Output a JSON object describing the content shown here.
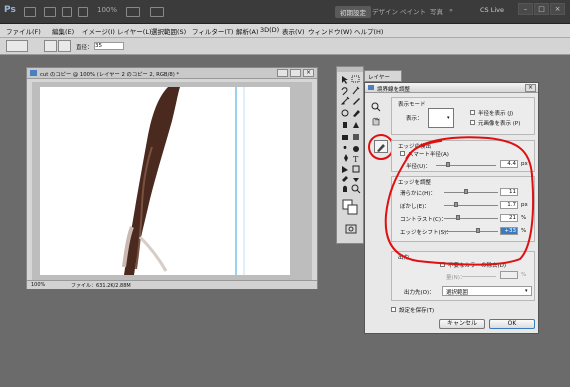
{
  "appbar": {
    "logo": "Ps",
    "zoom": "100%",
    "workspaces": [
      "初期設定",
      "デザイン",
      "ペイント",
      "写真"
    ],
    "cs_live": "CS Live",
    "more": "»"
  },
  "menu": {
    "items": [
      "ファイル(F)",
      "編集(E)",
      "イメージ(I)",
      "レイヤー(L)",
      "選択範囲(S)",
      "フィルター(T)",
      "解析(A)",
      "3D(D)",
      "表示(V)",
      "ウィンドウ(W)",
      "ヘルプ(H)"
    ]
  },
  "options": {
    "size_label": "直径：",
    "size_value": "35"
  },
  "document": {
    "title": "cut のコピー @ 100% (レイヤー 2 のコピー 2, RGB/8) *",
    "zoom": "100%",
    "file_info": "ファイル：631.2K/2.88M"
  },
  "layers_tab": "レイヤー",
  "dialog": {
    "title": "境界線を調整",
    "view_mode": {
      "group": "表示モード",
      "view_label": "表示：",
      "show_radius": "半径を表示 (J)",
      "show_original": "元画像を表示 (P)"
    },
    "edge_detection": {
      "group": "エッジの検出",
      "smart_radius": "スマート半径(A)",
      "radius_label": "半径(U)：",
      "radius_value": "4.4",
      "radius_unit": "px"
    },
    "adjust_edge": {
      "group": "エッジを調整",
      "rows": [
        {
          "label": "滑らかに(H)：",
          "value": "11",
          "unit": "",
          "pos": 0.4
        },
        {
          "label": "ぼかし(E)：",
          "value": "1.7",
          "unit": "px",
          "pos": 0.22
        },
        {
          "label": "コントラスト(C)：",
          "value": "21",
          "unit": "%",
          "pos": 0.25
        },
        {
          "label": "エッジをシフト(S)：",
          "value": "+33",
          "unit": "%",
          "pos": 0.63
        }
      ]
    },
    "output": {
      "group": "出力",
      "decontaminate": "不要なカラーの除去(D)",
      "amount_label": "量(N)：",
      "amount_unit": "%",
      "output_to_label": "出力先(O)：",
      "output_to_value": "選択範囲"
    },
    "remember": "設定を保存(T)",
    "cancel": "キャンセル",
    "ok": "OK"
  }
}
